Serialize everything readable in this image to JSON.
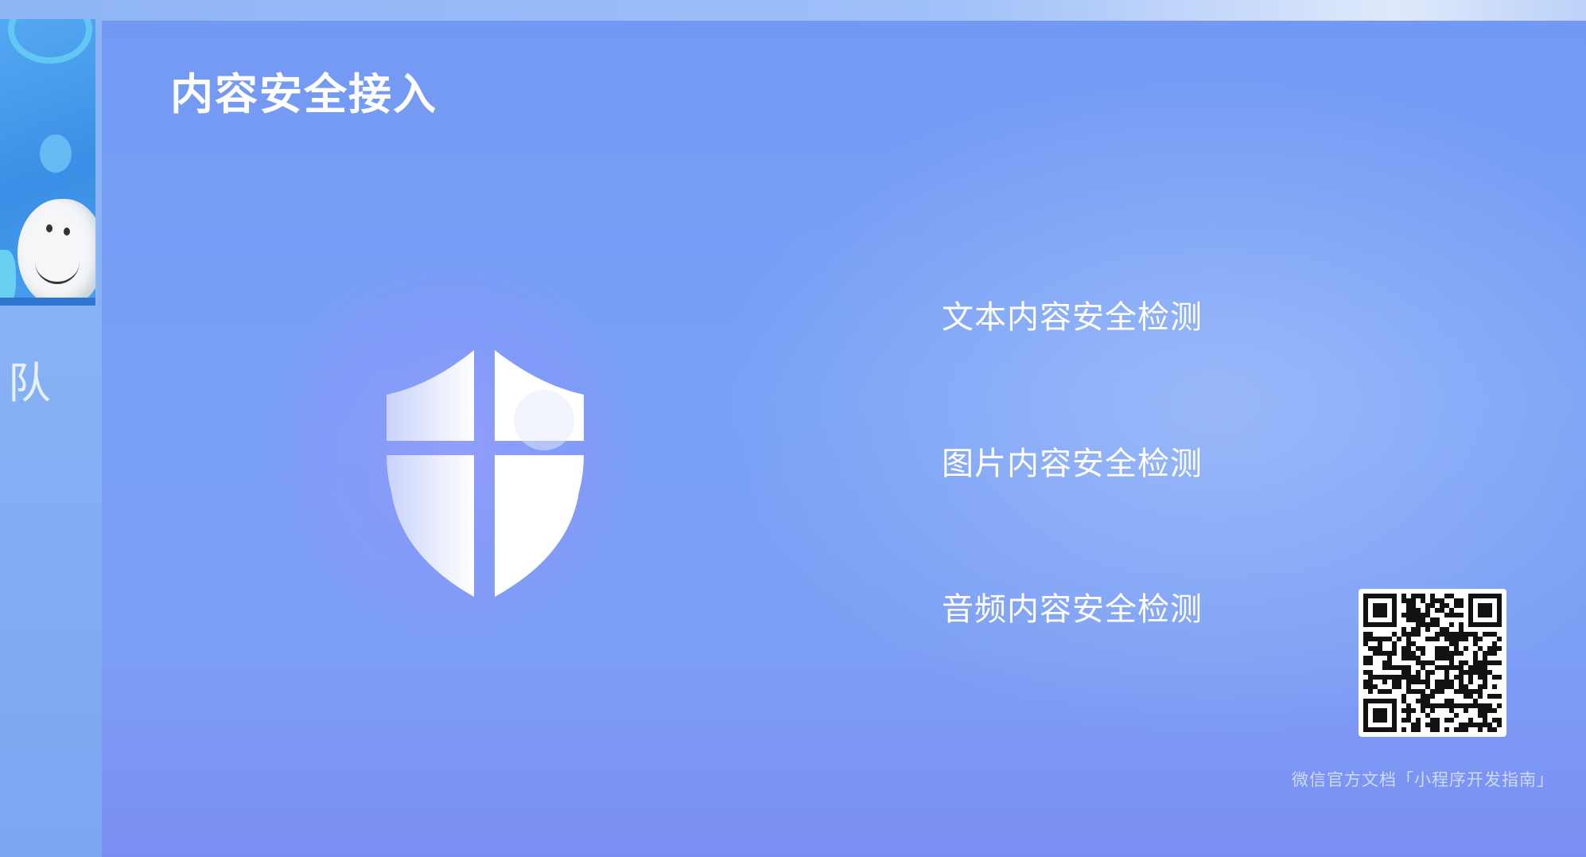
{
  "slide": {
    "title": "内容安全接入",
    "features": [
      "文本内容安全检测",
      "图片内容安全检测",
      "音频内容安全检测"
    ],
    "footer_note": "微信官方文档「小程序开发指南」",
    "shield_icon": "shield-icon",
    "qr_icon": "qr-code-icon"
  },
  "presenter": {
    "partial_text": "队"
  },
  "colors": {
    "background": "#7a9ef4",
    "text": "#ffffff"
  }
}
